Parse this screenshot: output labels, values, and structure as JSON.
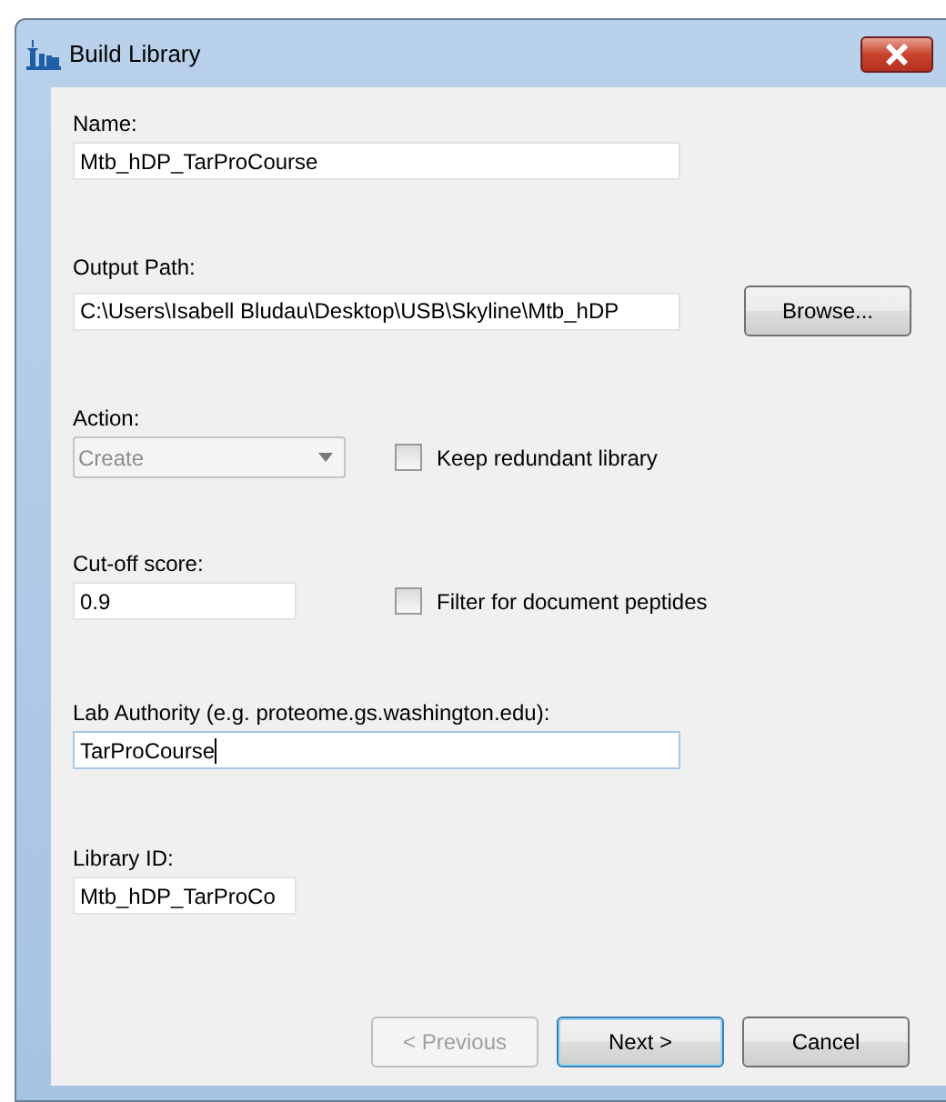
{
  "window": {
    "title": "Build Library"
  },
  "fields": [
    {
      "kind": "text",
      "label": "Name:",
      "value": "Mtb_hDP_TarProCourse",
      "focused": false
    },
    {
      "kind": "path",
      "label": "Output Path:",
      "value": "C:\\Users\\Isabell Bludau\\Desktop\\USB\\Skyline\\Mtb_hDP",
      "button": "Browse..."
    },
    {
      "kind": "combo",
      "label": "Action:",
      "value": "Create",
      "disabled": true,
      "checkbox": {
        "label": "Keep redundant library",
        "checked": false
      }
    },
    {
      "kind": "short-text",
      "label": "Cut-off score:",
      "value": "0.9",
      "focused": false,
      "checkbox": {
        "label": "Filter for document peptides",
        "checked": false
      }
    },
    {
      "kind": "text",
      "label": "Lab Authority (e.g. proteome.gs.washington.edu):",
      "value": "TarProCourse",
      "focused": true
    },
    {
      "kind": "short-text",
      "label": "Library ID:",
      "value": "Mtb_hDP_TarProCo",
      "focused": false
    }
  ],
  "buttons": [
    {
      "label": "< Previous",
      "disabled": true,
      "default": false
    },
    {
      "label": "Next >",
      "disabled": false,
      "default": true
    },
    {
      "label": "Cancel",
      "disabled": false,
      "default": false
    }
  ]
}
